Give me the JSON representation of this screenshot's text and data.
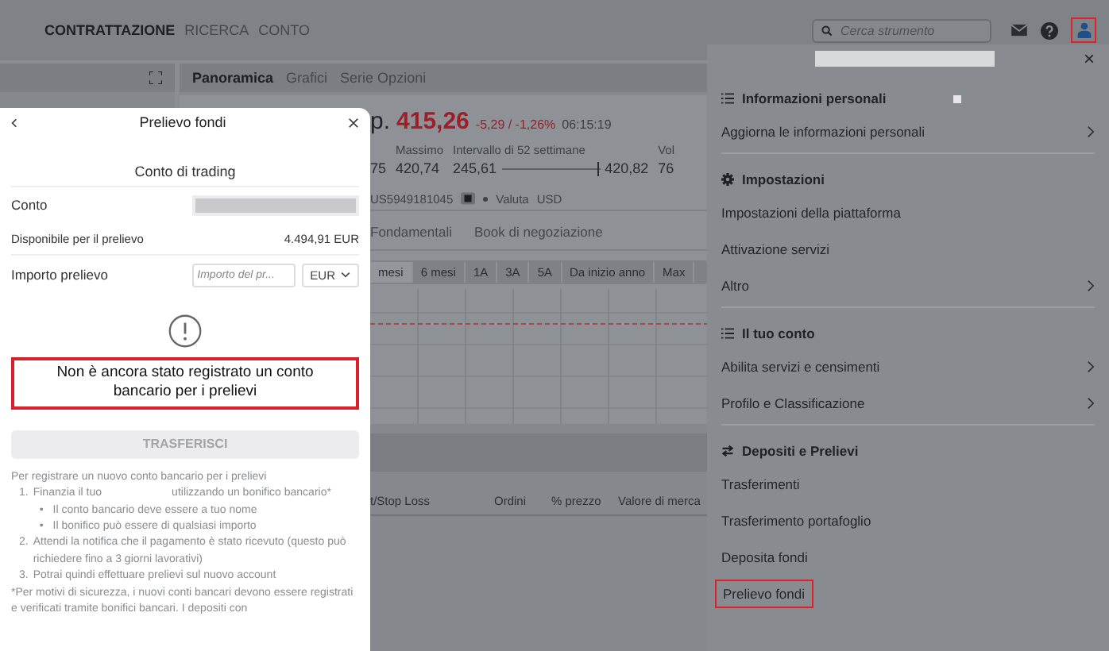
{
  "top_nav": {
    "tabs": [
      {
        "label": "CONTRATTAZIONE",
        "selected": true
      },
      {
        "label": "RICERCA",
        "selected": false
      },
      {
        "label": "CONTO",
        "selected": false
      }
    ],
    "search": {
      "placeholder": "Cerca strumento"
    },
    "user_button": {
      "highlighted": true
    }
  },
  "instrument_panel": {
    "tabs": [
      {
        "label": "Panoramica",
        "selected": true
      },
      {
        "label": "Grafici",
        "selected": false
      },
      {
        "label": "Serie Opzioni",
        "selected": false
      }
    ],
    "name_tail": "p.",
    "price": "415,26",
    "change": "-5,29 / -1,26%",
    "time": "06:15:19",
    "stats": [
      {
        "kind": "value",
        "value": "75"
      },
      {
        "kind": "value",
        "label": "Massimo",
        "value": "420,74"
      },
      {
        "kind": "range",
        "label": "Intervallo di 52 settimane",
        "low": "245,61",
        "high": "420,82",
        "level": 0.97
      },
      {
        "kind": "value",
        "label": "Vol",
        "value": "76"
      }
    ],
    "isin": "US5949181045",
    "currency_label": "Valuta",
    "currency": "USD",
    "sub_tabs": [
      {
        "label": "Fondamentali",
        "selected": false
      },
      {
        "label": "Book di negoziazione",
        "selected": false
      }
    ],
    "periods": [
      {
        "label": "mesi",
        "selected": true
      },
      {
        "label": "6 mesi",
        "selected": false
      },
      {
        "label": "1A",
        "selected": false
      },
      {
        "label": "3A",
        "selected": false
      },
      {
        "label": "5A",
        "selected": false
      },
      {
        "label": "Da inizio anno",
        "selected": false
      },
      {
        "label": "Max",
        "selected": false
      }
    ],
    "table": {
      "columns": [
        "t/Stop Loss",
        "Ordini",
        "% prezzo",
        "Valore di merca"
      ]
    }
  },
  "account_menu": {
    "close_label": "×",
    "sections": [
      {
        "kind": "list",
        "title": "Informazioni personali",
        "items": [
          {
            "label": "Aggiorna le informazioni personali",
            "has_submenu": true,
            "highlighted": false
          }
        ]
      },
      {
        "kind": "gear",
        "title": "Impostazioni",
        "items": [
          {
            "label": "Impostazioni della piattaforma",
            "has_submenu": false,
            "highlighted": false
          },
          {
            "label": "Attivazione servizi",
            "has_submenu": false,
            "highlighted": false
          },
          {
            "label": "Altro",
            "has_submenu": true,
            "highlighted": false
          }
        ]
      },
      {
        "kind": "list",
        "title": "Il tuo conto",
        "items": [
          {
            "label": "Abilita servizi e censimenti",
            "has_submenu": true,
            "highlighted": false
          },
          {
            "label": "Profilo e Classificazione",
            "has_submenu": true,
            "highlighted": false
          }
        ]
      },
      {
        "kind": "transfer",
        "title": "Depositi e Prelievi",
        "items": [
          {
            "label": "Trasferimenti",
            "has_submenu": false,
            "highlighted": false
          },
          {
            "label": "Trasferimento portafoglio",
            "has_submenu": false,
            "highlighted": false
          },
          {
            "label": "Deposita fondi",
            "has_submenu": false,
            "highlighted": false
          },
          {
            "label": "Prelievo fondi",
            "has_submenu": false,
            "highlighted": true
          }
        ]
      }
    ]
  },
  "withdraw_dialog": {
    "title": "Prelievo fondi",
    "account_type": "Conto di trading",
    "account_label": "Conto",
    "available_label": "Disponibile per il prelievo",
    "available_value": "4.494,91 EUR",
    "amount_label": "Importo prelievo",
    "amount_placeholder": "Importo del pr...",
    "currency": "EUR",
    "error": "Non è ancora stato registrato un conto bancario per i prelievi",
    "error_highlighted": true,
    "submit": {
      "label": "TRASFERISCI",
      "disabled": true
    },
    "instructions_title": "Per registrare un nuovo conto bancario per i prelievi",
    "bullet_marker": "•",
    "steps": [
      {
        "number": "1.",
        "text_before": "Finanzia il tuo",
        "text_after": "utilizzando un bonifico bancario*",
        "bullets": [
          "Il conto bancario deve essere a tuo nome",
          "Il bonifico può essere di qualsiasi importo"
        ]
      },
      {
        "number": "2.",
        "text_before": "Attendi la notifica che il pagamento è stato ricevuto (questo può richiedere fino a 3 giorni lavorativi)"
      },
      {
        "number": "3.",
        "text_before": "Potrai quindi effettuare prelievi sul nuovo account"
      }
    ],
    "footnote": "*Per motivi di sicurezza, i nuovi conti bancari devono essere registrati e verificati tramite bonifici bancari. I depositi con"
  }
}
